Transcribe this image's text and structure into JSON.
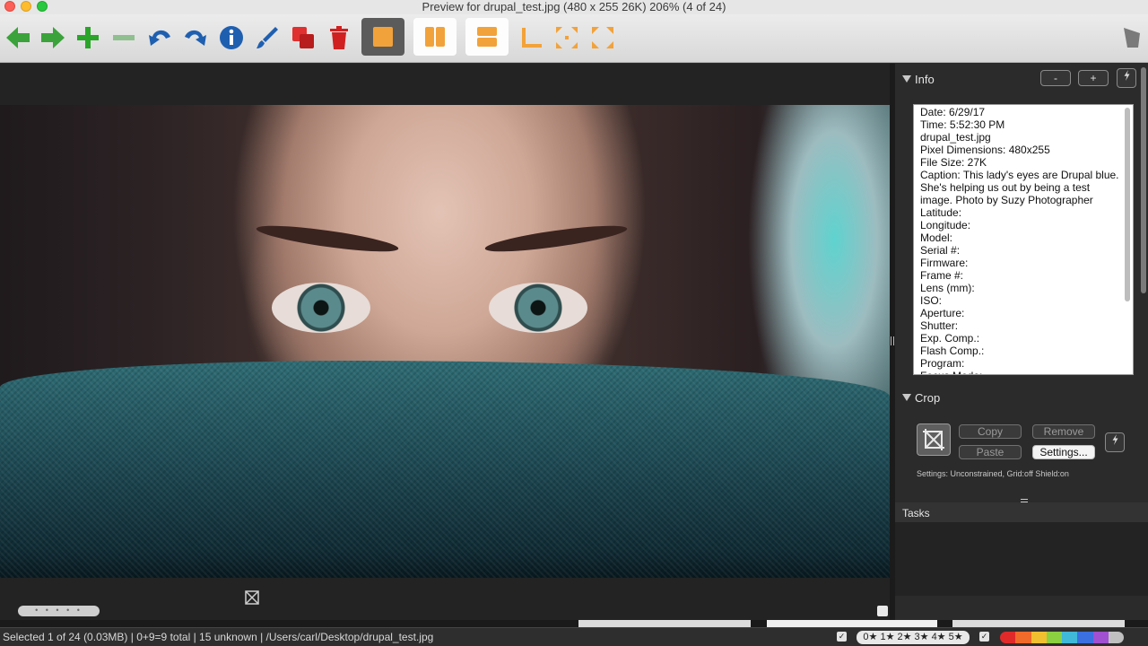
{
  "window": {
    "title": "Preview for drupal_test.jpg (480 x 255 26K) 206% (4 of 24)"
  },
  "toolbar": {
    "icons": [
      {
        "name": "back-arrow-icon",
        "color": "#3ca23c"
      },
      {
        "name": "forward-arrow-icon",
        "color": "#3ca23c"
      },
      {
        "name": "add-icon",
        "color": "#2aa52a"
      },
      {
        "name": "remove-icon",
        "color": "#8fbf8f"
      },
      {
        "name": "undo-icon",
        "color": "#1f5fb0"
      },
      {
        "name": "redo-icon",
        "color": "#1f5fb0"
      },
      {
        "name": "info-icon",
        "color": "#1f5fb0"
      },
      {
        "name": "edit-brush-icon",
        "color": "#1f5fb0"
      },
      {
        "name": "duplicate-icon",
        "color": "#d02020"
      },
      {
        "name": "trash-icon",
        "color": "#d02020"
      },
      {
        "name": "single-view-icon",
        "color": "#f2a23a"
      },
      {
        "name": "split-vertical-icon",
        "color": "#f2a23a"
      },
      {
        "name": "split-horizontal-icon",
        "color": "#f2a23a"
      },
      {
        "name": "corner-layout-icon",
        "color": "#f2a23a"
      },
      {
        "name": "grid-layout-icon",
        "color": "#f2a23a"
      },
      {
        "name": "expand-layout-icon",
        "color": "#f2a23a"
      },
      {
        "name": "tool-shield-icon",
        "color": "#7a7a7a"
      }
    ]
  },
  "info": {
    "title": "Info",
    "minus_label": "-",
    "plus_label": "+",
    "lines": [
      "Date: 6/29/17",
      "Time: 5:52:30 PM",
      "drupal_test.jpg",
      "Pixel Dimensions: 480x255",
      "File Size: 27K",
      "Caption: This lady's eyes are Drupal blue. She's helping us out by being a test image. Photo by Suzy Photographer",
      "Latitude:",
      "Longitude:",
      "Model:",
      "Serial #:",
      "Firmware:",
      "Frame #:",
      "Lens (mm):",
      "ISO:",
      "Aperture:",
      "Shutter:",
      "Exp. Comp.:",
      "Flash Comp.:",
      "Program:",
      "Focus Mode:"
    ]
  },
  "crop": {
    "title": "Crop",
    "copy_label": "Copy",
    "remove_label": "Remove",
    "paste_label": "Paste",
    "settings_label": "Settings...",
    "settings_line": "Settings:   Unconstrained, Grid:off Shield:on"
  },
  "tasks": {
    "title": "Tasks"
  },
  "status": {
    "text": "Selected 1 of 24 (0.03MB) | 0+9=9 total | 15 unknown | /Users/carl/Desktop/drupal_test.jpg",
    "rating_label": "0★ 1★ 2★ 3★ 4★ 5★",
    "check_mark": "✓"
  },
  "colors": {
    "labels": [
      "#e02a2a",
      "#f06a2a",
      "#f0c030",
      "#8ad040",
      "#40b8d8",
      "#3a70e0",
      "#a050d0",
      "#c0c0c0"
    ]
  }
}
